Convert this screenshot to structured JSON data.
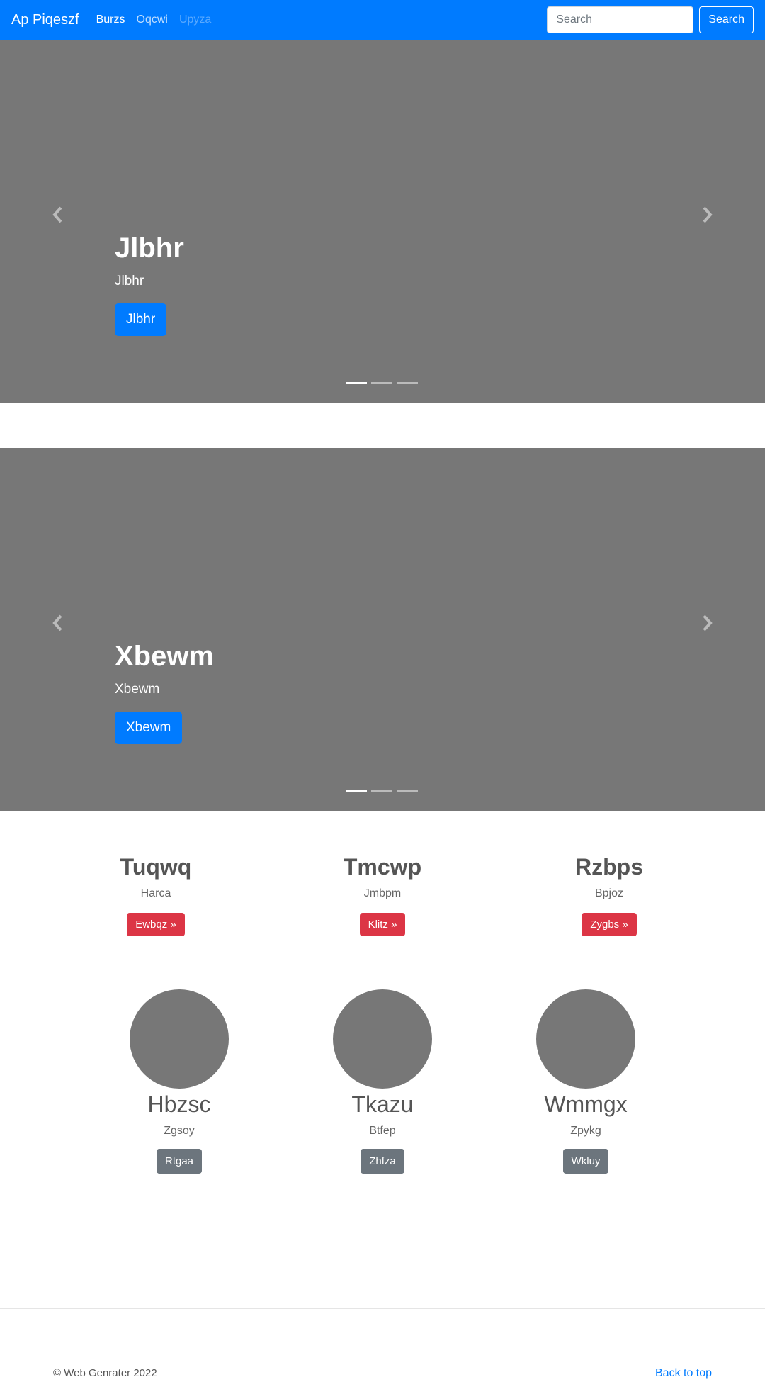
{
  "navbar": {
    "brand": "Ap Piqeszf",
    "links": [
      {
        "label": "Burzs",
        "state": "active"
      },
      {
        "label": "Oqcwi",
        "state": "normal"
      },
      {
        "label": "Upyza",
        "state": "disabled"
      }
    ],
    "search": {
      "placeholder": "Search",
      "button_label": "Search"
    }
  },
  "carousels": [
    {
      "title": "Jlbhr",
      "subtitle": "Jlbhr",
      "button_label": "Jlbhr",
      "active_indicator": 1,
      "indicator_count": 3
    },
    {
      "title": "Xbewm",
      "subtitle": "Xbewm",
      "button_label": "Xbewm",
      "active_indicator": 1,
      "indicator_count": 3
    }
  ],
  "features": [
    {
      "heading": "Tuqwq",
      "text": "Harca",
      "button_label": "Ewbqz »"
    },
    {
      "heading": "Tmcwp",
      "text": "Jmbpm",
      "button_label": "Klitz »"
    },
    {
      "heading": "Rzbps",
      "text": "Bpjoz",
      "button_label": "Zygbs »"
    }
  ],
  "members": [
    {
      "name": "Hbzsc",
      "text": "Zgsoy",
      "button_label": "Rtgaa"
    },
    {
      "name": "Tkazu",
      "text": "Btfep",
      "button_label": "Zhfza"
    },
    {
      "name": "Wmmgx",
      "text": "Zpykg",
      "button_label": "Wkluy"
    }
  ],
  "footer": {
    "copyright": "© Web Genrater 2022",
    "back_to_top": "Back to top"
  },
  "colors": {
    "primary": "#007bff",
    "danger": "#dc3545",
    "secondary": "#6c757d",
    "placeholder_gray": "#777777"
  }
}
